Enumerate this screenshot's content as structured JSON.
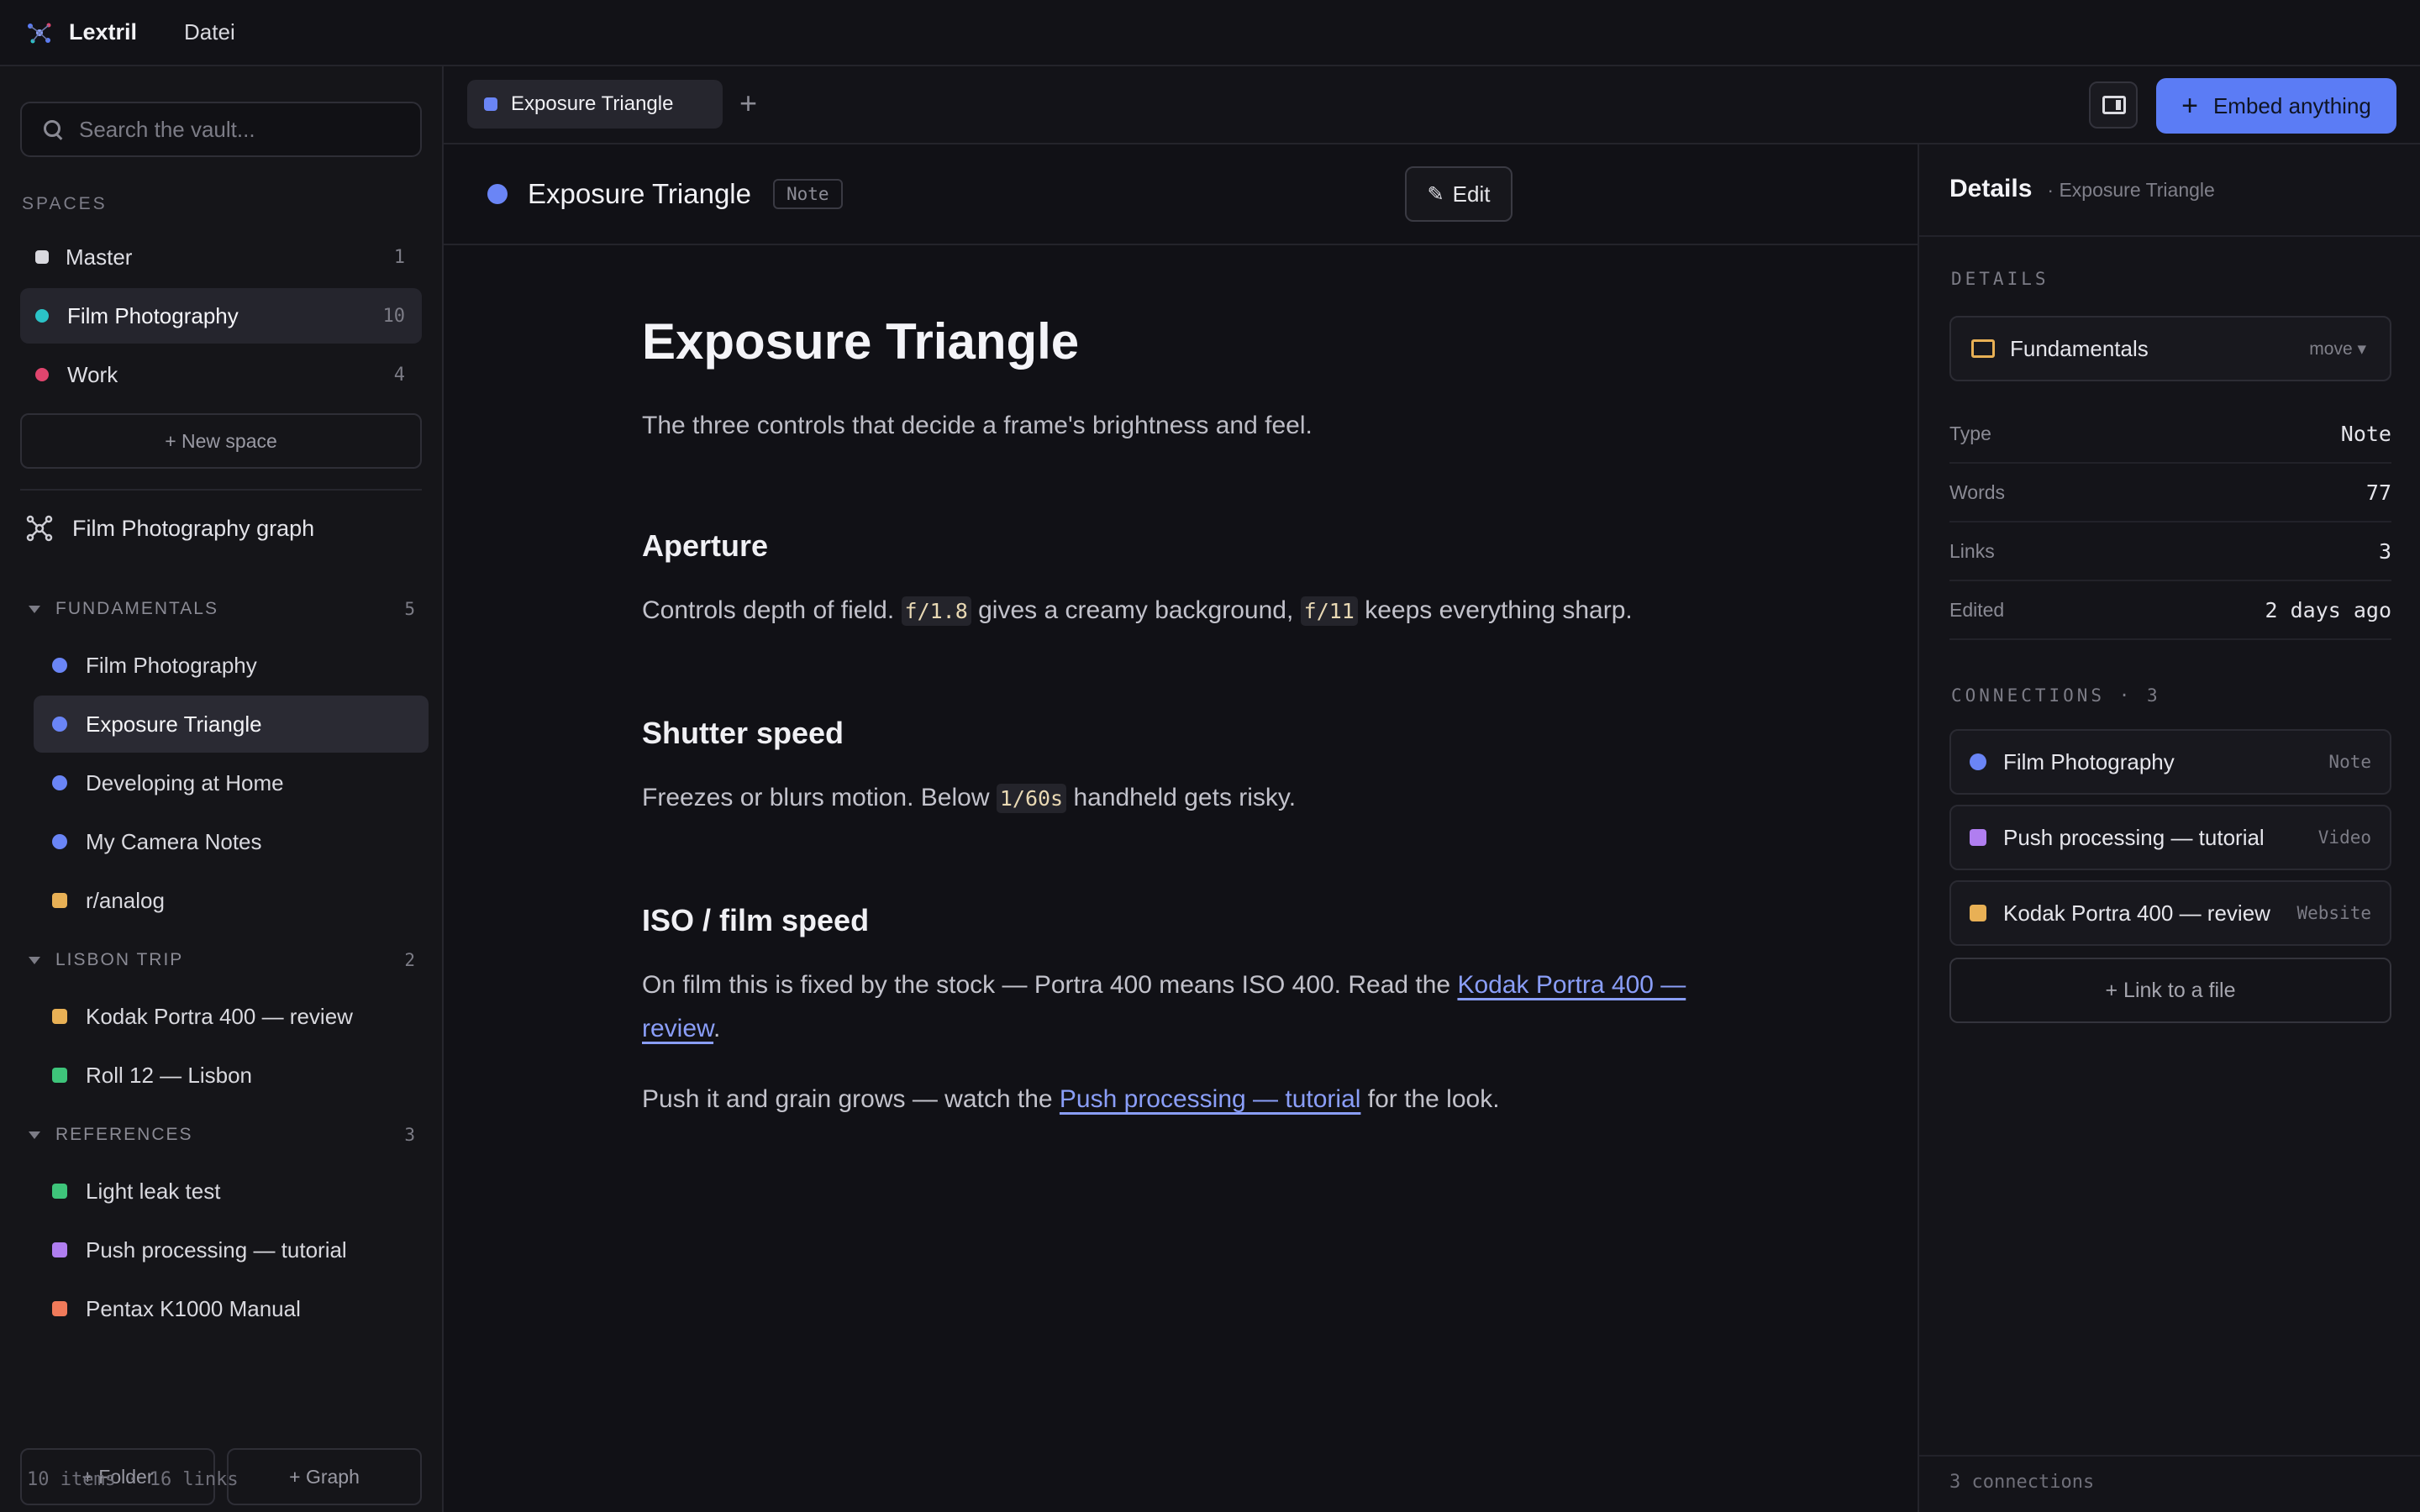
{
  "app": {
    "name": "Lextril",
    "menu": [
      "Datei"
    ]
  },
  "search": {
    "placeholder": "Search the vault..."
  },
  "spaces": {
    "label": "SPACES",
    "items": [
      {
        "label": "Master",
        "count": "1",
        "color": "#d9d9df"
      },
      {
        "label": "Film Photography",
        "count": "10",
        "color": "#2bc3c7"
      },
      {
        "label": "Work",
        "count": "4",
        "color": "#e0456e"
      }
    ],
    "new_space": "+ New space"
  },
  "graph": {
    "label": "Film Photography graph"
  },
  "folders": [
    {
      "label": "FUNDAMENTALS",
      "count": "5",
      "items": [
        {
          "label": "Film Photography",
          "color": "#6a85f6",
          "shape": "dot"
        },
        {
          "label": "Exposure Triangle",
          "color": "#6a85f6",
          "shape": "dot"
        },
        {
          "label": "Developing at Home",
          "color": "#6a85f6",
          "shape": "dot"
        },
        {
          "label": "My Camera Notes",
          "color": "#6a85f6",
          "shape": "dot"
        },
        {
          "label": "r/analog",
          "color": "#e8b055",
          "shape": "square"
        }
      ]
    },
    {
      "label": "LISBON TRIP",
      "count": "2",
      "items": [
        {
          "label": "Kodak Portra 400 — review",
          "color": "#e8b055",
          "shape": "square"
        },
        {
          "label": "Roll 12 — Lisbon",
          "color": "#3ec47a",
          "shape": "square"
        }
      ]
    },
    {
      "label": "REFERENCES",
      "count": "3",
      "items": [
        {
          "label": "Light leak test",
          "color": "#3ec47a",
          "shape": "square"
        },
        {
          "label": "Push processing — tutorial",
          "color": "#b07ef0",
          "shape": "square"
        },
        {
          "label": "Pentax K1000 Manual",
          "color": "#f07a5a",
          "shape": "square"
        }
      ]
    }
  ],
  "sidebar_buttons": {
    "folder": "+ Folder",
    "graph": "+ Graph"
  },
  "sidebar_footer": "10 items · 16 links",
  "tabs": [
    {
      "label": "Exposure Triangle",
      "color": "#6a85f6"
    }
  ],
  "tab_add": "+",
  "embed_button": {
    "label": "Embed anything",
    "plus": "+"
  },
  "note": {
    "title": "Exposure Triangle",
    "badge": "Note",
    "edit_label": "Edit",
    "edit_icon": "pencil-icon"
  },
  "doc": {
    "title": "Exposure Triangle",
    "lead": "The three controls that decide a frame's brightness and feel.",
    "aperture": {
      "heading": "Aperture",
      "t1": "Controls depth of field. ",
      "c1": "f/1.8",
      "t2": " gives a creamy background, ",
      "c2": "f/11",
      "t3": " keeps everything sharp."
    },
    "shutter": {
      "heading": "Shutter speed",
      "t1": "Freezes or blurs motion. Below ",
      "c1": "1/60s",
      "t2": " handheld gets risky."
    },
    "iso": {
      "heading": "ISO / film speed",
      "t1": "On film this is fixed by the stock — Portra 400 means ISO 400. Read the ",
      "link1": "Kodak Portra 400 — review",
      "t2": ".",
      "t3": "Push it and grain grows — watch the ",
      "link2": "Push processing — tutorial",
      "t4": " for the look."
    }
  },
  "details": {
    "title": "Details",
    "subtitle": "· Exposure Triangle",
    "section": "DETAILS",
    "folder": {
      "name": "Fundamentals",
      "move": "move ▾"
    },
    "props": [
      {
        "key": "Type",
        "value": "Note"
      },
      {
        "key": "Words",
        "value": "77"
      },
      {
        "key": "Links",
        "value": "3"
      },
      {
        "key": "Edited",
        "value": "2 days ago"
      }
    ],
    "connections_label": "CONNECTIONS · 3",
    "connections": [
      {
        "label": "Film Photography",
        "type": "Note",
        "color": "#6a85f6",
        "shape": "dot"
      },
      {
        "label": "Push processing — tutorial",
        "type": "Video",
        "color": "#b07ef0",
        "shape": "square"
      },
      {
        "label": "Kodak Portra 400 — review",
        "type": "Website",
        "color": "#e8b055",
        "shape": "square"
      }
    ],
    "link_file": "+ Link to a file",
    "footer": "3 connections"
  }
}
